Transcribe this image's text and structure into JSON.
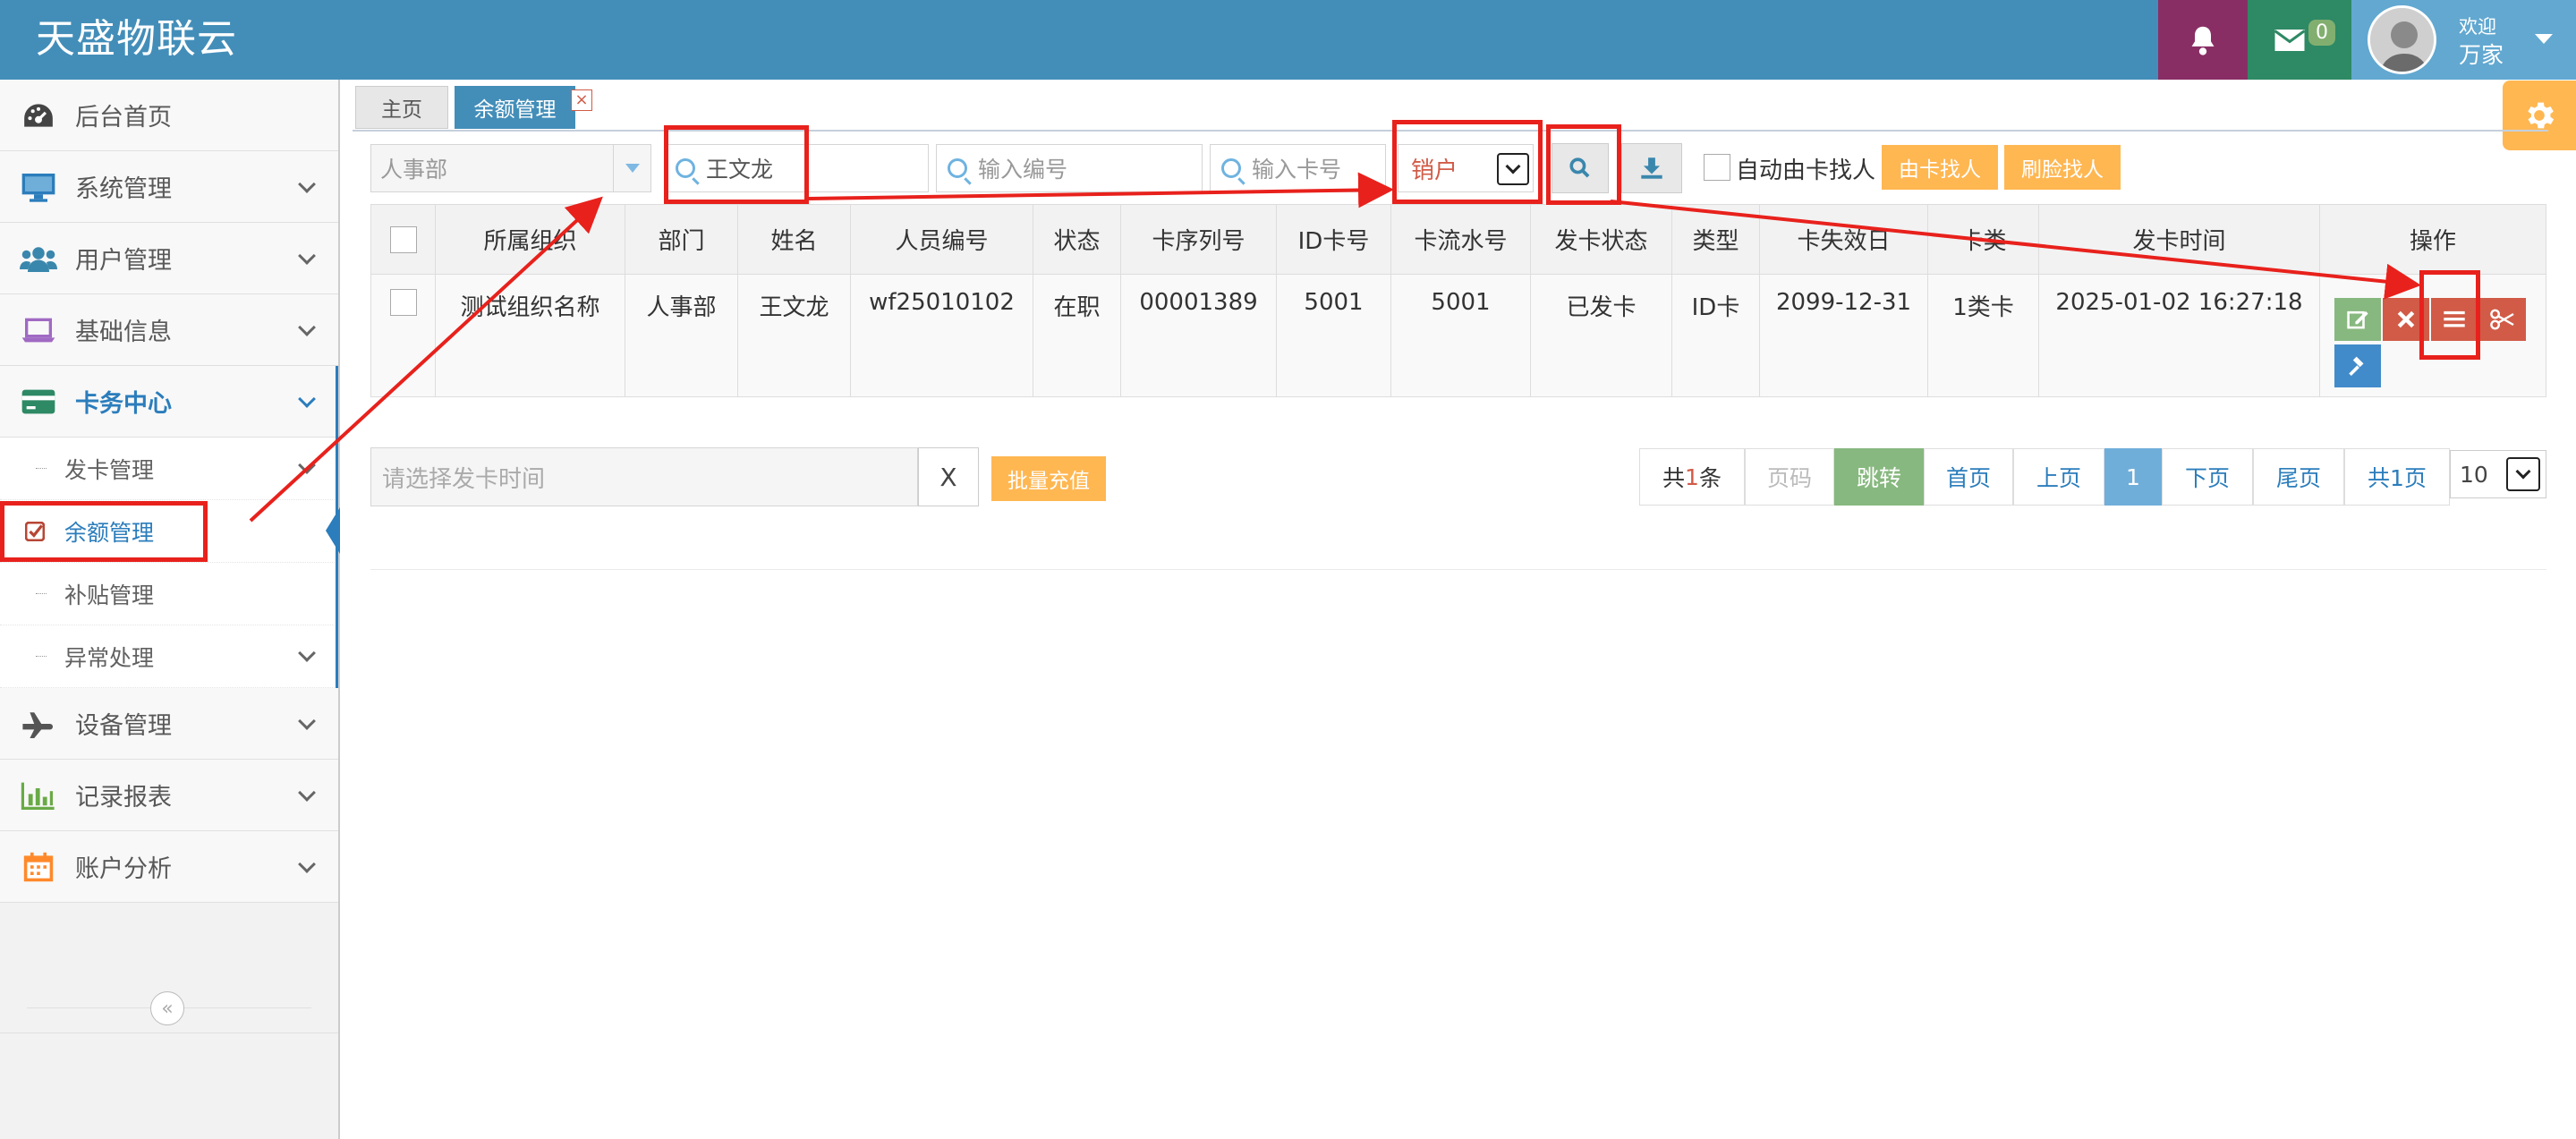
{
  "navbar": {
    "brand": "天盛物联云",
    "mail_badge": "0",
    "welcome": "欢迎",
    "user_name": "万家"
  },
  "sidebar": {
    "items": [
      {
        "label": "后台首页"
      },
      {
        "label": "系统管理"
      },
      {
        "label": "用户管理"
      },
      {
        "label": "基础信息"
      },
      {
        "label": "卡务中心"
      },
      {
        "label": "设备管理"
      },
      {
        "label": "记录报表"
      },
      {
        "label": "账户分析"
      }
    ],
    "subitems": [
      {
        "label": "发卡管理"
      },
      {
        "label": "余额管理"
      },
      {
        "label": "补贴管理"
      },
      {
        "label": "异常处理"
      }
    ],
    "collapse": "«"
  },
  "tabs": [
    {
      "label": "主页"
    },
    {
      "label": "余额管理"
    }
  ],
  "toolbar": {
    "dept_value": "人事部",
    "name_value": "王文龙",
    "empno_placeholder": "输入编号",
    "cardno_placeholder": "输入卡号",
    "status_value": "销户",
    "auto_find_label": "自动由卡找人",
    "card_find_label": "由卡找人",
    "face_find_label": "刷脸找人"
  },
  "table": {
    "headers": [
      "所属组织",
      "部门",
      "姓名",
      "人员编号",
      "状态",
      "卡序列号",
      "ID卡号",
      "卡流水号",
      "发卡状态",
      "类型",
      "卡失效日",
      "卡类",
      "发卡时间",
      "操作"
    ],
    "rows": [
      {
        "org": "测试组织名称",
        "dept": "人事部",
        "name": "王文龙",
        "emp_no": "wf25010102",
        "status": "在职",
        "serial": "00001389",
        "id_card": "5001",
        "flow_no": "5001",
        "issue_status": "已发卡",
        "type": "ID卡",
        "expire": "2099-12-31",
        "card_class": "1类卡",
        "issue_time": "2025-01-02 16:27:18"
      }
    ]
  },
  "bottom": {
    "date_placeholder": "请选择发卡时间",
    "clear_label": "X",
    "batch_label": "批量充值"
  },
  "pagination": {
    "total_prefix": "共",
    "total_num": "1",
    "total_suffix": "条",
    "page_input_placeholder": "页码",
    "jump": "跳转",
    "first": "首页",
    "prev": "上页",
    "current": "1",
    "next": "下页",
    "last": "尾页",
    "page_count": "共1页",
    "page_size": "10"
  },
  "colors": {
    "navbar": "#438eb9",
    "accent": "#2b7dbc",
    "annotation": "#e8211c",
    "warning": "#ffb752"
  }
}
